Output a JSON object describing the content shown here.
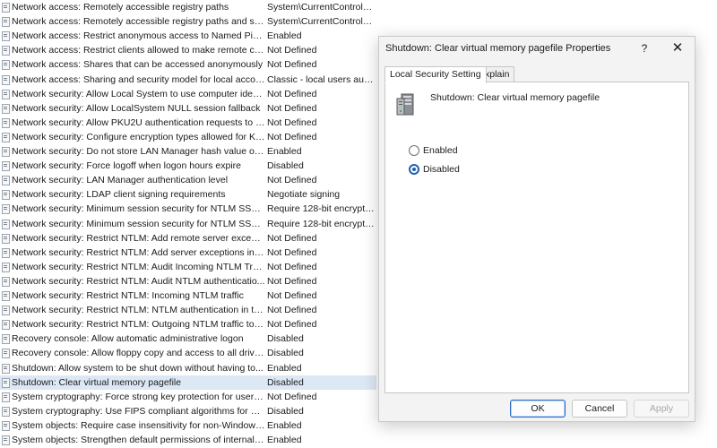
{
  "policies": [
    {
      "name": "Network access: Remotely accessible registry paths",
      "value": "System\\CurrentControlS..."
    },
    {
      "name": "Network access: Remotely accessible registry paths and sub...",
      "value": "System\\CurrentControlS..."
    },
    {
      "name": "Network access: Restrict anonymous access to Named Pipes...",
      "value": "Enabled"
    },
    {
      "name": "Network access: Restrict clients allowed to make remote call...",
      "value": "Not Defined"
    },
    {
      "name": "Network access: Shares that can be accessed anonymously",
      "value": "Not Defined"
    },
    {
      "name": "Network access: Sharing and security model for local accou...",
      "value": "Classic - local users auth..."
    },
    {
      "name": "Network security: Allow Local System to use computer ident...",
      "value": "Not Defined"
    },
    {
      "name": "Network security: Allow LocalSystem NULL session fallback",
      "value": "Not Defined"
    },
    {
      "name": "Network security: Allow PKU2U authentication requests to t...",
      "value": "Not Defined"
    },
    {
      "name": "Network security: Configure encryption types allowed for Ke...",
      "value": "Not Defined"
    },
    {
      "name": "Network security: Do not store LAN Manager hash value on ...",
      "value": "Enabled"
    },
    {
      "name": "Network security: Force logoff when logon hours expire",
      "value": "Disabled"
    },
    {
      "name": "Network security: LAN Manager authentication level",
      "value": "Not Defined"
    },
    {
      "name": "Network security: LDAP client signing requirements",
      "value": "Negotiate signing"
    },
    {
      "name": "Network security: Minimum session security for NTLM SSP ...",
      "value": "Require 128-bit encrypti..."
    },
    {
      "name": "Network security: Minimum session security for NTLM SSP ...",
      "value": "Require 128-bit encrypti..."
    },
    {
      "name": "Network security: Restrict NTLM: Add remote server excepti...",
      "value": "Not Defined"
    },
    {
      "name": "Network security: Restrict NTLM: Add server exceptions in t...",
      "value": "Not Defined"
    },
    {
      "name": "Network security: Restrict NTLM: Audit Incoming NTLM Traf...",
      "value": "Not Defined"
    },
    {
      "name": "Network security: Restrict NTLM: Audit NTLM authenticatio...",
      "value": "Not Defined"
    },
    {
      "name": "Network security: Restrict NTLM: Incoming NTLM traffic",
      "value": "Not Defined"
    },
    {
      "name": "Network security: Restrict NTLM: NTLM authentication in thi...",
      "value": "Not Defined"
    },
    {
      "name": "Network security: Restrict NTLM: Outgoing NTLM traffic to r...",
      "value": "Not Defined"
    },
    {
      "name": "Recovery console: Allow automatic administrative logon",
      "value": "Disabled"
    },
    {
      "name": "Recovery console: Allow floppy copy and access to all drives...",
      "value": "Disabled"
    },
    {
      "name": "Shutdown: Allow system to be shut down without having to...",
      "value": "Enabled"
    },
    {
      "name": "Shutdown: Clear virtual memory pagefile",
      "value": "Disabled",
      "selected": true
    },
    {
      "name": "System cryptography: Force strong key protection for user k...",
      "value": "Not Defined"
    },
    {
      "name": "System cryptography: Use FIPS compliant algorithms for en...",
      "value": "Disabled"
    },
    {
      "name": "System objects: Require case insensitivity for non-Windows ...",
      "value": "Enabled"
    },
    {
      "name": "System objects: Strengthen default permissions of internal s...",
      "value": "Enabled"
    }
  ],
  "dialog": {
    "title": "Shutdown: Clear virtual memory pagefile Properties",
    "help_label": "?",
    "close_label": "✕",
    "tabs": [
      {
        "label": "Local Security Setting",
        "active": true
      },
      {
        "label": "Explain",
        "active": false
      }
    ],
    "policy_icon": "server-icon",
    "policy_name": "Shutdown: Clear virtual memory pagefile",
    "options": [
      {
        "label": "Enabled",
        "checked": false
      },
      {
        "label": "Disabled",
        "checked": true
      }
    ],
    "buttons": {
      "ok": "OK",
      "cancel": "Cancel",
      "apply": "Apply"
    }
  },
  "colors": {
    "selection": "#dde8f5",
    "accent": "#1f5fae"
  }
}
